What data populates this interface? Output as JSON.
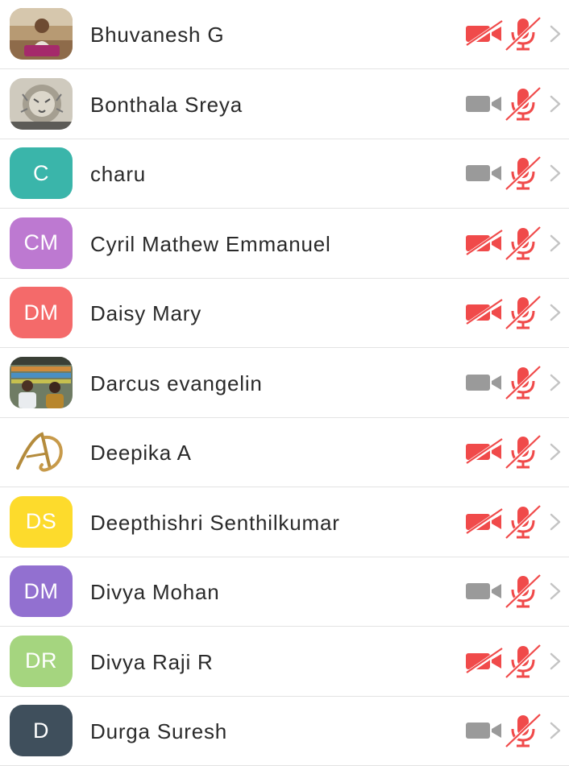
{
  "colors": {
    "muted_red": "#f04a4a",
    "inactive_gray": "#9a9a9a",
    "chevron": "#c4c4c4"
  },
  "participants": [
    {
      "name": "Bhuvanesh G",
      "avatar": {
        "type": "photo",
        "icon": "person-portrait-photo"
      },
      "video_muted": true,
      "audio_muted": true
    },
    {
      "name": "Bonthala Sreya",
      "avatar": {
        "type": "photo",
        "icon": "lion-sketch-photo"
      },
      "video_muted": false,
      "audio_muted": true
    },
    {
      "name": "charu",
      "avatar": {
        "type": "initials",
        "initials": "C",
        "color": "#3ab5aa"
      },
      "video_muted": false,
      "audio_muted": true
    },
    {
      "name": "Cyril Mathew Emmanuel",
      "avatar": {
        "type": "initials",
        "initials": "CM",
        "color": "#bd79d1"
      },
      "video_muted": true,
      "audio_muted": true
    },
    {
      "name": "Daisy Mary",
      "avatar": {
        "type": "initials",
        "initials": "DM",
        "color": "#f46a6a"
      },
      "video_muted": true,
      "audio_muted": true
    },
    {
      "name": "Darcus evangelin",
      "avatar": {
        "type": "photo",
        "icon": "couple-in-store-photo"
      },
      "video_muted": false,
      "audio_muted": true
    },
    {
      "name": "Deepika A",
      "avatar": {
        "type": "photo",
        "icon": "ad-monogram-logo"
      },
      "video_muted": true,
      "audio_muted": true
    },
    {
      "name": "Deepthishri Senthilkumar",
      "avatar": {
        "type": "initials",
        "initials": "DS",
        "color": "#fddb2c"
      },
      "video_muted": true,
      "audio_muted": true
    },
    {
      "name": "Divya Mohan",
      "avatar": {
        "type": "initials",
        "initials": "DM",
        "color": "#9270d0"
      },
      "video_muted": false,
      "audio_muted": true
    },
    {
      "name": "Divya Raji R",
      "avatar": {
        "type": "initials",
        "initials": "DR",
        "color": "#a5d57f"
      },
      "video_muted": true,
      "audio_muted": true
    },
    {
      "name": "Durga Suresh",
      "avatar": {
        "type": "initials",
        "initials": "D",
        "color": "#3f4f5c"
      },
      "video_muted": false,
      "audio_muted": true
    }
  ]
}
